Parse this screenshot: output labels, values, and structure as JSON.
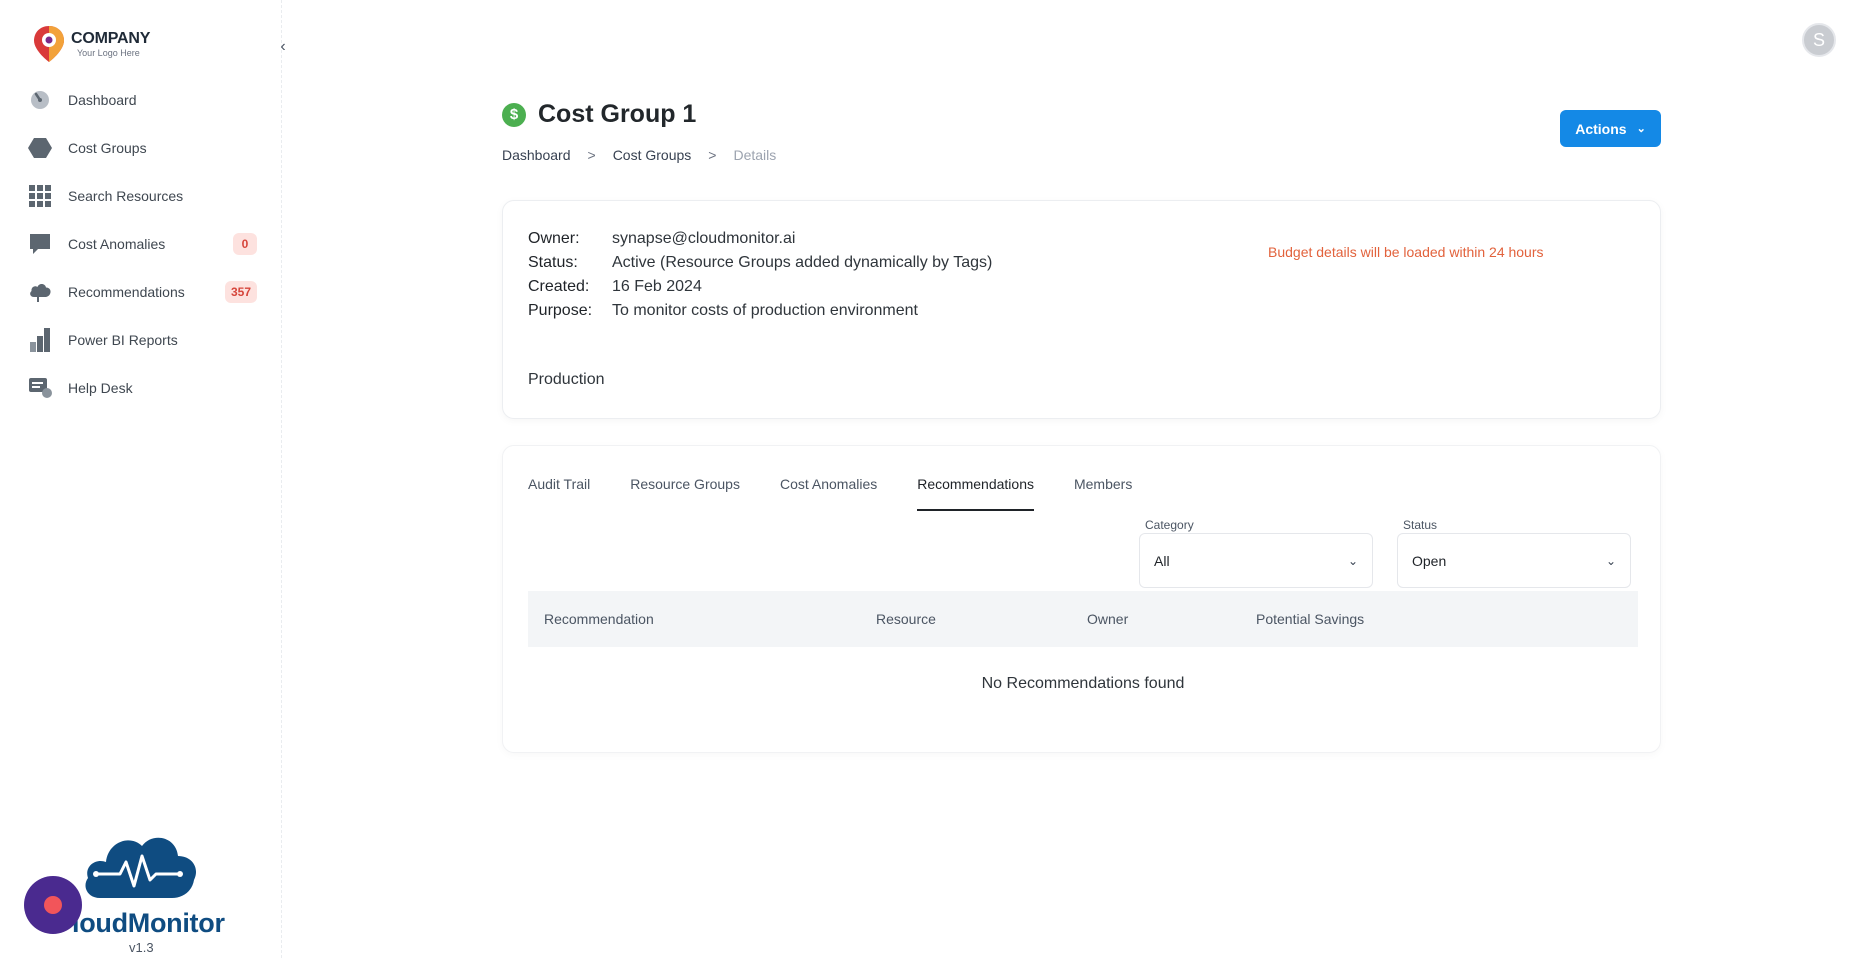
{
  "logo": {
    "title": "COMPANY",
    "subtitle": "Your Logo Here"
  },
  "sidebar": {
    "items": [
      {
        "label": "Dashboard",
        "icon": "dashboard-gauge-icon"
      },
      {
        "label": "Cost Groups",
        "icon": "hexagon-icon"
      },
      {
        "label": "Search Resources",
        "icon": "grid-icon"
      },
      {
        "label": "Cost Anomalies",
        "icon": "chat-bubble-icon",
        "badge": "0"
      },
      {
        "label": "Recommendations",
        "icon": "cloud-icon",
        "badge": "357"
      },
      {
        "label": "Power BI Reports",
        "icon": "bar-chart-icon"
      },
      {
        "label": "Help Desk",
        "icon": "help-desk-icon"
      }
    ],
    "brand": "loudMonitor",
    "version": "v1.3"
  },
  "user": {
    "avatar_initial": "S"
  },
  "header": {
    "title": "Cost Group 1",
    "title_icon_glyph": "$",
    "breadcrumb": [
      "Dashboard",
      ">",
      "Cost Groups",
      ">",
      "Details"
    ],
    "actions_label": "Actions"
  },
  "info": {
    "rows": [
      {
        "key": "Owner:",
        "value": "synapse@cloudmonitor.ai"
      },
      {
        "key": "Status:",
        "value": "Active (Resource Groups added dynamically by Tags)"
      },
      {
        "key": "Created:",
        "value": "16 Feb 2024"
      },
      {
        "key": "Purpose:",
        "value": "To monitor costs of production environment"
      }
    ],
    "budget_note": "Budget details will be loaded within 24 hours",
    "tag": "Production"
  },
  "tabs": {
    "items": [
      "Audit Trail",
      "Resource Groups",
      "Cost Anomalies",
      "Recommendations",
      "Members"
    ],
    "active": "Recommendations"
  },
  "filters": {
    "category": {
      "label": "Category",
      "value": "All"
    },
    "status": {
      "label": "Status",
      "value": "Open"
    }
  },
  "table": {
    "columns": [
      "Recommendation",
      "Resource",
      "Owner",
      "Potential Savings"
    ],
    "empty_message": "No Recommendations found"
  },
  "colors": {
    "primary": "#1489e6",
    "badge_bg": "#fde2df",
    "badge_text": "#d6453b",
    "budget_note": "#e2623c",
    "brand": "#0f4c81",
    "title_icon": "#4caf50"
  }
}
